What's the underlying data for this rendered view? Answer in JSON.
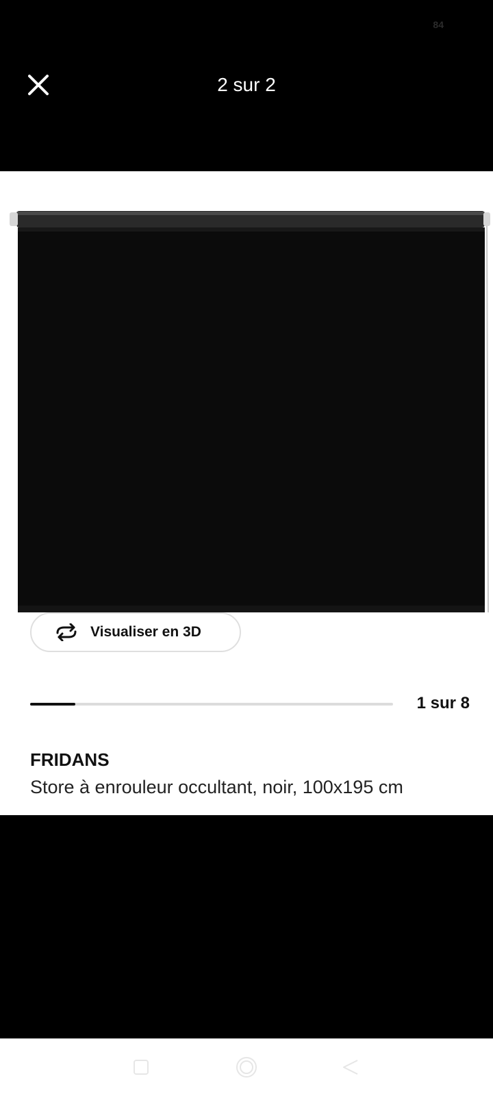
{
  "status_bar": {
    "battery": "84"
  },
  "viewer": {
    "counter": "2 sur 2",
    "close_icon": "close-icon"
  },
  "product": {
    "view_3d_label": "Visualiser en 3D",
    "view_3d_icon": "rotate-3d-icon",
    "image_counter": "1 sur 8",
    "image_progress": 0.125,
    "name": "FRIDANS",
    "description": "Store à enrouleur occultant, noir, 100x195 cm"
  },
  "nav_bar": {
    "items": [
      "recent-apps-icon",
      "home-icon",
      "back-icon"
    ]
  }
}
